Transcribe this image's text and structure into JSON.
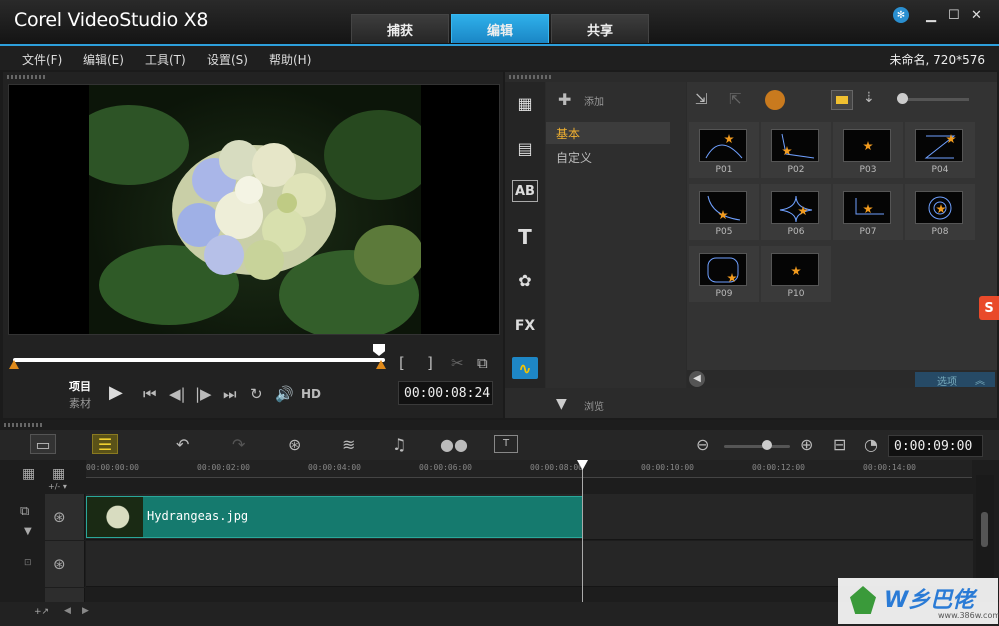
{
  "app": {
    "title": "Corel VideoStudio X8",
    "project_info": "未命名, 720*576"
  },
  "tabs": [
    {
      "label": "捕获"
    },
    {
      "label": "编辑"
    },
    {
      "label": "共享"
    }
  ],
  "menu": [
    "文件(F)",
    "编辑(E)",
    "工具(T)",
    "设置(S)",
    "帮助(H)"
  ],
  "player": {
    "mode_project": "项目",
    "mode_clip": "素材",
    "hd_label": "HD",
    "timecode": "00:00:08:24",
    "bracket_in": "[",
    "bracket_out": "]"
  },
  "library": {
    "add_label": "添加",
    "categories": [
      "基本",
      "自定义"
    ],
    "browse_label": "浏览",
    "options_label": "选项",
    "side_icons": [
      "media-icon",
      "instant-project-icon",
      "transition-icon",
      "title-icon",
      "graphic-icon",
      "filter-icon",
      "path-icon"
    ],
    "items": [
      "P01",
      "P02",
      "P03",
      "P04",
      "P05",
      "P06",
      "P07",
      "P08",
      "P09",
      "P10"
    ]
  },
  "timeline": {
    "timecode": "0:00:09:00",
    "ruler": [
      "00:00:00:00",
      "00:00:02:00",
      "00:00:04:00",
      "00:00:06:00",
      "00:00:08:00",
      "00:00:10:00",
      "00:00:12:00",
      "00:00:14:00"
    ],
    "clip_name": "Hydrangeas.jpg"
  },
  "watermark": {
    "text": "W乡巴佬",
    "url": "www.386w.com"
  },
  "colors": {
    "accent": "#2d9fdb",
    "clip": "#157a6e",
    "marker": "#e08a1a"
  }
}
